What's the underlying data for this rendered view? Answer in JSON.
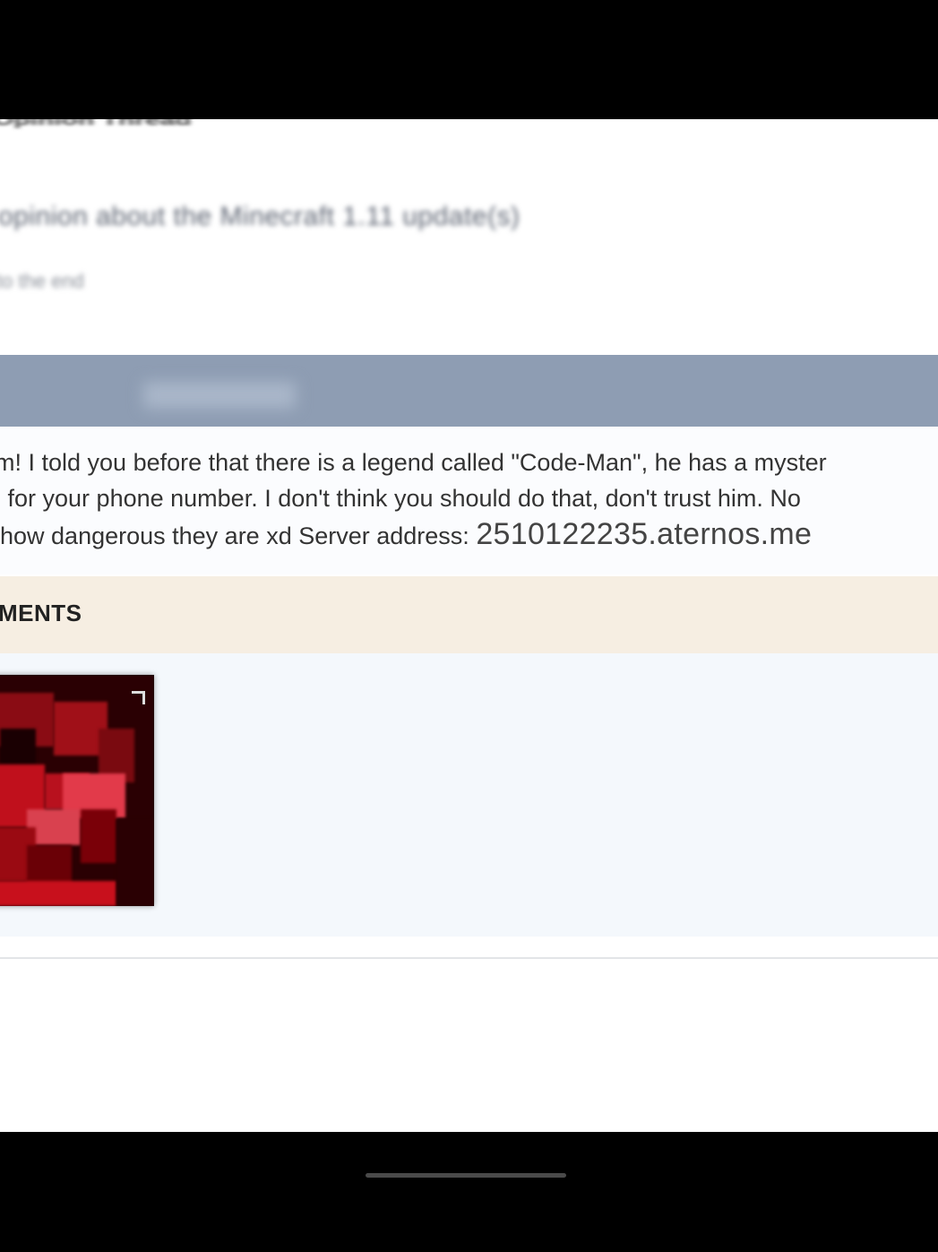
{
  "thread": {
    "title_fragment": "Opinion Thread",
    "subject": "opinion about the Minecraft 1.11 update(s)",
    "meta": "to the end"
  },
  "post": {
    "line1": "m! I told you before that there is a legend called \"Code-Man\", he has a myster",
    "line2": "u for your phone number. I don't think you should do that, don't trust him. No",
    "line3_prefix": "how dangerous they are xd Server address: ",
    "server_address": "2510122235.aternos.me"
  },
  "attachments": {
    "label": "MENTS"
  },
  "colors": {
    "header_bar": "#8e9db3",
    "attachments_bar": "#f6eee2",
    "attachments_body": "#f4f8fc",
    "thumbnail_red": "#c0101c"
  }
}
